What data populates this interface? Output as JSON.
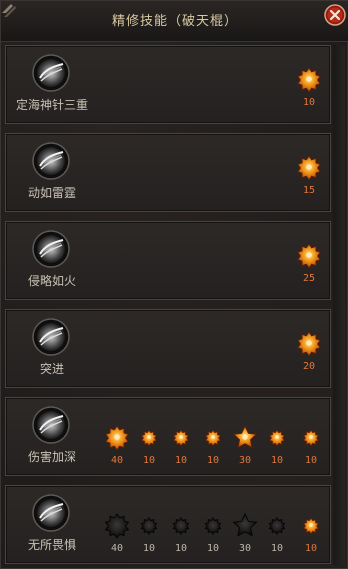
{
  "window": {
    "title": "精修技能（破天棍）"
  },
  "skills": [
    {
      "name": "定海神针三重",
      "slots": [
        {
          "value": "10",
          "state": "active-large"
        }
      ]
    },
    {
      "name": "动如雷霆",
      "slots": [
        {
          "value": "15",
          "state": "active-large"
        }
      ]
    },
    {
      "name": "侵略如火",
      "slots": [
        {
          "value": "25",
          "state": "active-large"
        }
      ]
    },
    {
      "name": "突进",
      "slots": [
        {
          "value": "20",
          "state": "active-large"
        }
      ]
    },
    {
      "name": "伤害加深",
      "slots": [
        {
          "value": "40",
          "state": "active-large"
        },
        {
          "value": "10",
          "state": "active-small"
        },
        {
          "value": "10",
          "state": "active-small"
        },
        {
          "value": "10",
          "state": "active-small"
        },
        {
          "value": "30",
          "state": "active-star"
        },
        {
          "value": "10",
          "state": "active-small"
        },
        {
          "value": "10",
          "state": "active-small"
        }
      ]
    },
    {
      "name": "无所畏惧",
      "slots": [
        {
          "value": "40",
          "state": "locked-large"
        },
        {
          "value": "10",
          "state": "locked-small"
        },
        {
          "value": "10",
          "state": "locked-small"
        },
        {
          "value": "10",
          "state": "locked-small"
        },
        {
          "value": "30",
          "state": "locked-star"
        },
        {
          "value": "10",
          "state": "locked-small"
        },
        {
          "value": "10",
          "state": "active-small"
        }
      ]
    }
  ],
  "colors": {
    "active_value": "#e0773c",
    "locked_value": "#bdb6ab",
    "title": "#d9c9a3"
  },
  "icons": {
    "skill": "cudgel-swirl-icon",
    "active": "orange-star-gem-icon",
    "locked": "dark-star-gem-icon",
    "close": "close-icon"
  }
}
